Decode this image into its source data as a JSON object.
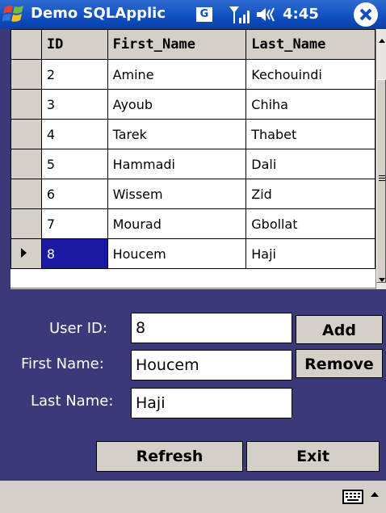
{
  "window": {
    "title": "Demo SQLApplic",
    "time": "4:45",
    "status_letter": "G"
  },
  "grid": {
    "columns": [
      "ID",
      "First_Name",
      "Last_Name"
    ],
    "rows": [
      {
        "id": "2",
        "first": "Amine",
        "last": "Kechouindi"
      },
      {
        "id": "3",
        "first": "Ayoub",
        "last": "Chiha"
      },
      {
        "id": "4",
        "first": "Tarek",
        "last": "Thabet"
      },
      {
        "id": "5",
        "first": "Hammadi",
        "last": "Dali"
      },
      {
        "id": "6",
        "first": "Wissem",
        "last": "Zid"
      },
      {
        "id": "7",
        "first": "Mourad",
        "last": "Gbollat"
      },
      {
        "id": "8",
        "first": "Houcem",
        "last": "Haji"
      }
    ],
    "selected_id": "8"
  },
  "form": {
    "user_id_label": "User ID:",
    "first_name_label": "First Name:",
    "last_name_label": "Last Name:",
    "user_id_value": "8",
    "first_name_value": "Houcem",
    "last_name_value": "Haji"
  },
  "buttons": {
    "add": "Add",
    "remove": "Remove",
    "refresh": "Refresh",
    "exit": "Exit"
  },
  "colors": {
    "titlebar": "#0f4fc0",
    "form_background": "#3a3a7a",
    "selection": "#1a1aa0"
  },
  "icons": [
    "windows-logo-icon",
    "signal-icon",
    "volume-icon",
    "close-icon",
    "keyboard-icon"
  ]
}
